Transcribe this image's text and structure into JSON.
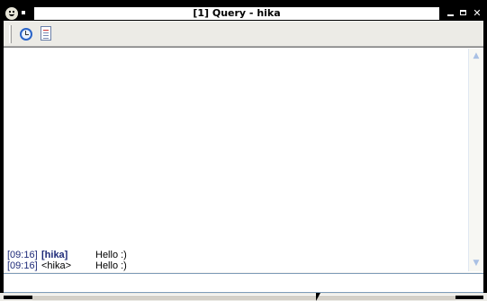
{
  "window": {
    "title": "[1] Query - hika"
  },
  "titlebar_buttons": {
    "minimize": "–",
    "maximize": "□",
    "close": "✕"
  },
  "toolbar": {
    "items": [
      {
        "name": "history-icon"
      },
      {
        "name": "log-icon"
      }
    ]
  },
  "chat": {
    "lines": [
      {
        "time": "[09:16]",
        "nick": "[hika]",
        "message": "Hello :)"
      },
      {
        "time": "[09:16]",
        "nick": "<hika>",
        "message": "Hello :)"
      }
    ]
  },
  "input": {
    "value": "",
    "placeholder": ""
  },
  "colors": {
    "timestamp": "#1e2a78",
    "titlebar": "#000000",
    "scroll_arrow": "#a9c0e4"
  }
}
